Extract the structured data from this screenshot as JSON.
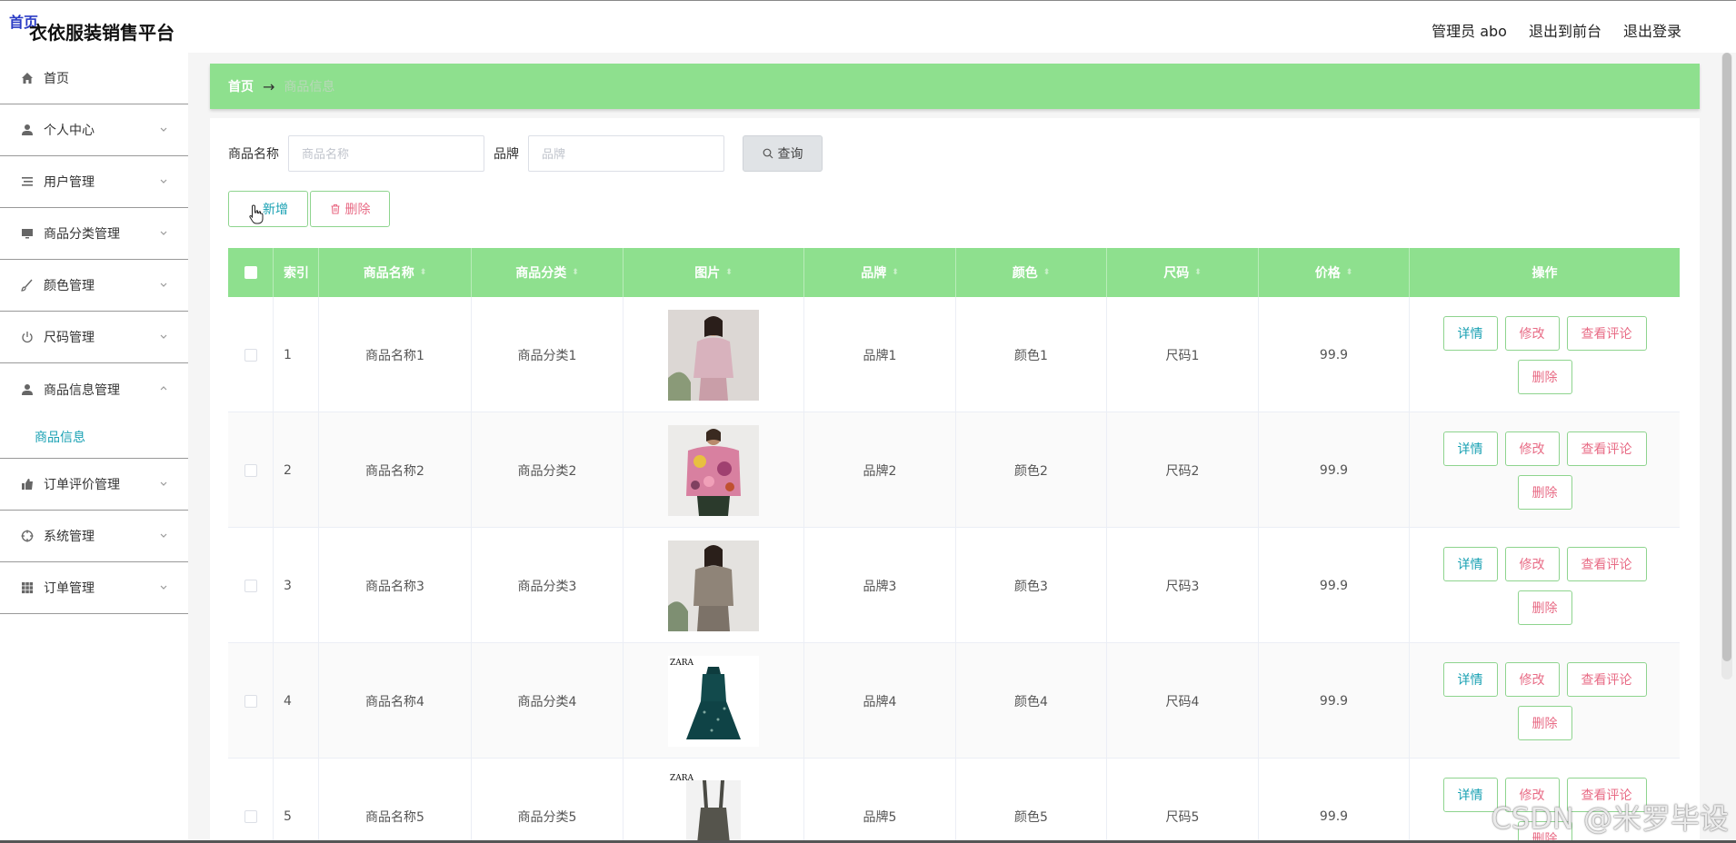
{
  "header": {
    "logo_badge": "首页",
    "title": "衣依服装销售平台",
    "user_label": "管理员 abo",
    "front_link": "退出到前台",
    "logout_link": "退出登录"
  },
  "sidebar": {
    "items": [
      {
        "label": "首页",
        "icon": "home-icon"
      },
      {
        "label": "个人中心",
        "icon": "user-icon"
      },
      {
        "label": "用户管理",
        "icon": "list-icon"
      },
      {
        "label": "商品分类管理",
        "icon": "monitor-icon"
      },
      {
        "label": "颜色管理",
        "icon": "brush-icon"
      },
      {
        "label": "尺码管理",
        "icon": "power-icon"
      },
      {
        "label": "商品信息管理",
        "icon": "person-icon"
      },
      {
        "label": "订单评价管理",
        "icon": "thumb-icon"
      },
      {
        "label": "系统管理",
        "icon": "target-icon"
      },
      {
        "label": "订单管理",
        "icon": "grid-icon"
      }
    ],
    "submenu": {
      "label": "商品信息"
    }
  },
  "breadcrumb": {
    "home": "首页",
    "arrow": "→",
    "current": "商品信息"
  },
  "search": {
    "name_label": "商品名称",
    "name_placeholder": "商品名称",
    "brand_label": "品牌",
    "brand_placeholder": "品牌",
    "query_button": "查询"
  },
  "actions": {
    "add_button": "新增",
    "delete_button": "删除"
  },
  "table": {
    "headers": {
      "index": "索引",
      "name": "商品名称",
      "category": "商品分类",
      "image": "图片",
      "brand": "品牌",
      "color": "颜色",
      "size": "尺码",
      "price": "价格",
      "ops": "操作"
    },
    "op_labels": {
      "detail": "详情",
      "edit": "修改",
      "review": "查看评论",
      "remove": "删除"
    },
    "rows": [
      {
        "index": "1",
        "name": "商品名称1",
        "category": "商品分类1",
        "brand": "品牌1",
        "color": "颜色1",
        "size": "尺码1",
        "price": "99.9",
        "image": "photo-woman-pink-sweater"
      },
      {
        "index": "2",
        "name": "商品名称2",
        "category": "商品分类2",
        "brand": "品牌2",
        "color": "颜色2",
        "size": "尺码2",
        "price": "99.9",
        "image": "photo-floral-jacket"
      },
      {
        "index": "3",
        "name": "商品名称3",
        "category": "商品分类3",
        "brand": "品牌3",
        "color": "颜色3",
        "size": "尺码3",
        "price": "99.9",
        "image": "photo-woman-grey-sweater"
      },
      {
        "index": "4",
        "name": "商品名称4",
        "category": "商品分类4",
        "brand": "品牌4",
        "color": "颜色4",
        "size": "尺码4",
        "price": "99.9",
        "image": "photo-zara-green-dress"
      },
      {
        "index": "5",
        "name": "商品名称5",
        "category": "商品分类5",
        "brand": "品牌5",
        "color": "颜色5",
        "size": "尺码5",
        "price": "99.9",
        "image": "photo-zara-pinafore"
      }
    ],
    "image_texts": [
      "ZARA",
      "ZARA"
    ]
  },
  "watermark": "CSDN @米罗毕设",
  "colors": {
    "accent_green": "#8ee08e",
    "teal_text": "#19a1b3",
    "pink_text": "#e86b85"
  }
}
